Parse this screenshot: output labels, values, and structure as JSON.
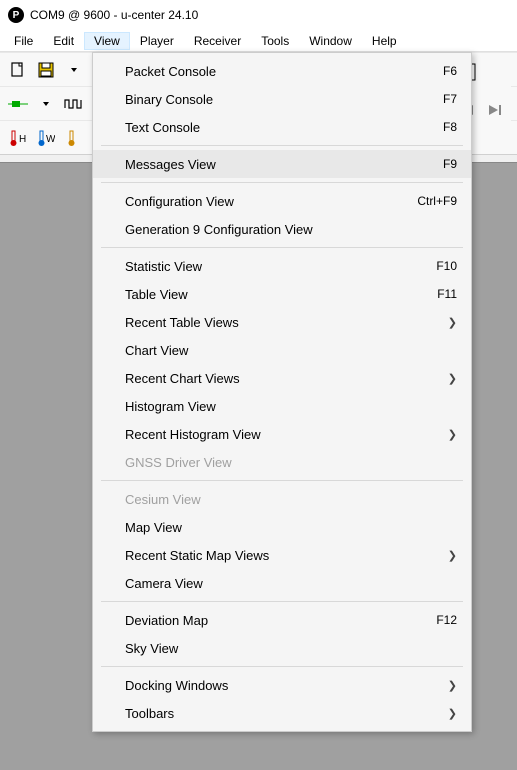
{
  "window": {
    "title": "COM9 @ 9600 - u-center 24.10"
  },
  "menubar": {
    "items": [
      {
        "label": "File"
      },
      {
        "label": "Edit"
      },
      {
        "label": "View"
      },
      {
        "label": "Player"
      },
      {
        "label": "Receiver"
      },
      {
        "label": "Tools"
      },
      {
        "label": "Window"
      },
      {
        "label": "Help"
      }
    ]
  },
  "dropdown": {
    "items": [
      {
        "label": "Packet Console",
        "accel": "F6",
        "submenu": false,
        "disabled": false
      },
      {
        "label": "Binary Console",
        "accel": "F7",
        "submenu": false,
        "disabled": false
      },
      {
        "label": "Text Console",
        "accel": "F8",
        "submenu": false,
        "disabled": false
      },
      {
        "sep": true
      },
      {
        "label": "Messages View",
        "accel": "F9",
        "submenu": false,
        "disabled": false,
        "hover": true
      },
      {
        "sep": true
      },
      {
        "label": "Configuration View",
        "accel": "Ctrl+F9",
        "submenu": false,
        "disabled": false
      },
      {
        "label": "Generation 9 Configuration View",
        "accel": "",
        "submenu": false,
        "disabled": false
      },
      {
        "sep": true
      },
      {
        "label": "Statistic View",
        "accel": "F10",
        "submenu": false,
        "disabled": false
      },
      {
        "label": "Table View",
        "accel": "F11",
        "submenu": false,
        "disabled": false
      },
      {
        "label": "Recent Table Views",
        "accel": "",
        "submenu": true,
        "disabled": false
      },
      {
        "label": "Chart View",
        "accel": "",
        "submenu": false,
        "disabled": false
      },
      {
        "label": "Recent Chart Views",
        "accel": "",
        "submenu": true,
        "disabled": false
      },
      {
        "label": "Histogram View",
        "accel": "",
        "submenu": false,
        "disabled": false
      },
      {
        "label": "Recent Histogram View",
        "accel": "",
        "submenu": true,
        "disabled": false
      },
      {
        "label": "GNSS Driver View",
        "accel": "",
        "submenu": false,
        "disabled": true
      },
      {
        "sep": true
      },
      {
        "label": "Cesium View",
        "accel": "",
        "submenu": false,
        "disabled": true
      },
      {
        "label": "Map View",
        "accel": "",
        "submenu": false,
        "disabled": false
      },
      {
        "label": "Recent Static Map Views",
        "accel": "",
        "submenu": true,
        "disabled": false
      },
      {
        "label": "Camera View",
        "accel": "",
        "submenu": false,
        "disabled": false
      },
      {
        "sep": true
      },
      {
        "label": "Deviation Map",
        "accel": "F12",
        "submenu": false,
        "disabled": false
      },
      {
        "label": "Sky View",
        "accel": "",
        "submenu": false,
        "disabled": false
      },
      {
        "sep": true
      },
      {
        "label": "Docking Windows",
        "accel": "",
        "submenu": true,
        "disabled": false
      },
      {
        "label": "Toolbars",
        "accel": "",
        "submenu": true,
        "disabled": false
      }
    ]
  },
  "icons": {
    "app": "P"
  }
}
